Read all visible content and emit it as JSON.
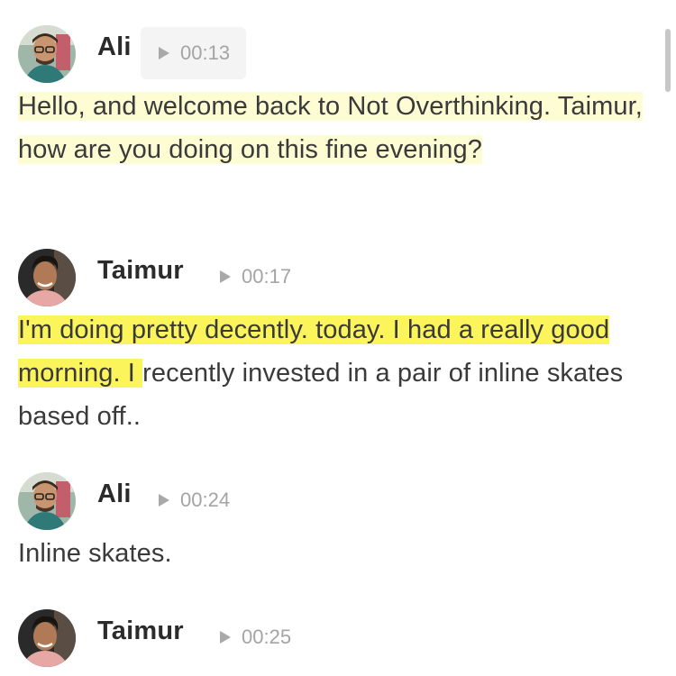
{
  "transcript": {
    "entries": [
      {
        "speaker": "Ali",
        "timestamp": "00:13",
        "segments": [
          {
            "text": "Hello, and welcome back to Not Overthinking. Taimur, how are you ",
            "highlight": "soft"
          },
          {
            "text": "doing on this fine evening?",
            "highlight": "soft"
          }
        ]
      },
      {
        "speaker": "Taimur",
        "timestamp": "00:17",
        "segments": [
          {
            "text": "I'm doing pretty decently. today. I had a really good morning. I ",
            "highlight": "strong"
          },
          {
            "text": "recently invested in a pair of inline skates based off..",
            "highlight": "none"
          }
        ]
      },
      {
        "speaker": "Ali",
        "timestamp": "00:24",
        "segments": [
          {
            "text": "Inline skates.",
            "highlight": "none"
          }
        ]
      },
      {
        "speaker": "Taimur",
        "timestamp": "00:25",
        "segments": []
      }
    ]
  },
  "colors": {
    "highlight_soft": "#fdfcd3",
    "highlight_strong": "#fbf45a",
    "timestamp_text": "#a4a4a4",
    "text": "#3a3a3a"
  },
  "icons": {
    "play": "play-icon",
    "avatar_ali": "avatar",
    "avatar_taimur": "avatar"
  }
}
